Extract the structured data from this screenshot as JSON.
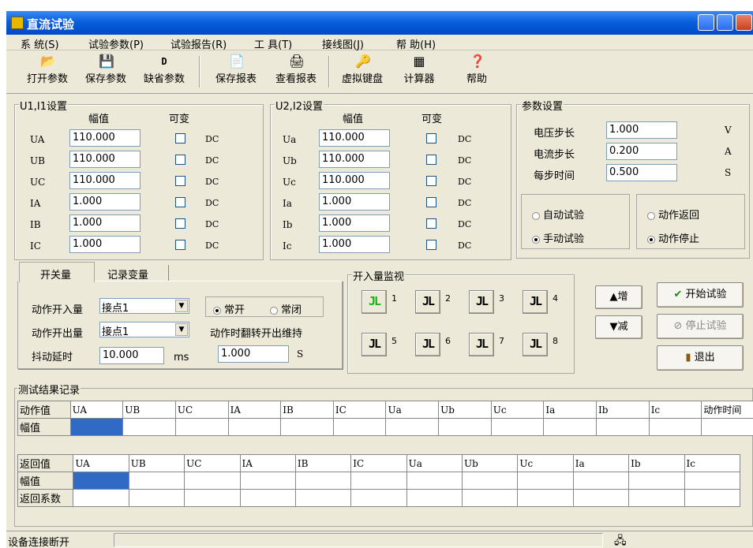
{
  "window": {
    "title": "直流试验"
  },
  "menu": [
    "系 统(S)",
    "试验参数(P)",
    "试验报告(R)",
    "工 具(T)",
    "接线图(J)",
    "帮 助(H)"
  ],
  "toolbar": [
    "打开参数",
    "保存参数",
    "缺省参数",
    "保存报表",
    "查看报表",
    "虚拟键盘",
    "计算器",
    "帮助"
  ],
  "g1": {
    "title": "U1,I1设置",
    "amp_header": "幅值",
    "var_header": "可变",
    "rows": [
      {
        "label": "UA",
        "value": "110.000",
        "unit": "DC"
      },
      {
        "label": "UB",
        "value": "110.000",
        "unit": "DC"
      },
      {
        "label": "UC",
        "value": "110.000",
        "unit": "DC"
      },
      {
        "label": "IA",
        "value": "1.000",
        "unit": "DC"
      },
      {
        "label": "IB",
        "value": "1.000",
        "unit": "DC"
      },
      {
        "label": "IC",
        "value": "1.000",
        "unit": "DC"
      }
    ]
  },
  "g2": {
    "title": "U2,I2设置",
    "amp_header": "幅值",
    "var_header": "可变",
    "rows": [
      {
        "label": "Ua",
        "value": "110.000",
        "unit": "DC"
      },
      {
        "label": "Ub",
        "value": "110.000",
        "unit": "DC"
      },
      {
        "label": "Uc",
        "value": "110.000",
        "unit": "DC"
      },
      {
        "label": "Ia",
        "value": "1.000",
        "unit": "DC"
      },
      {
        "label": "Ib",
        "value": "1.000",
        "unit": "DC"
      },
      {
        "label": "Ic",
        "value": "1.000",
        "unit": "DC"
      }
    ]
  },
  "params": {
    "title": "参数设置",
    "rows": [
      {
        "label": "电压步长",
        "value": "1.000",
        "unit": "V"
      },
      {
        "label": "电流步长",
        "value": "0.200",
        "unit": "A"
      },
      {
        "label": "每步时间",
        "value": "0.500",
        "unit": "S"
      }
    ],
    "mode_auto": "自动试验",
    "mode_manual": "手动试验",
    "act_return": "动作返回",
    "act_stop": "动作停止"
  },
  "tabs": {
    "t1": "开关量",
    "t2": "记录变量",
    "in_label": "动作开入量",
    "in_value": "接点1",
    "out_label": "动作开出量",
    "out_value": "接点1",
    "delay_label": "抖动延时",
    "delay_value": "10.000",
    "delay_unit": "ms",
    "no": "常开",
    "nc": "常闭",
    "hold_label": "动作时翻转开出维持",
    "hold_value": "1.000",
    "hold_unit": "S"
  },
  "monitor": {
    "title": "开入量监视",
    "glyph": "JL",
    "nums": [
      "1",
      "2",
      "3",
      "4",
      "5",
      "6",
      "7",
      "8"
    ],
    "lit_state": "input 1 active (green)"
  },
  "buttons": {
    "inc": "增",
    "dec": "减",
    "start": "开始试验",
    "stop": "停止试验",
    "exit": "退出"
  },
  "results": {
    "title": "测试结果记录",
    "t1_header": [
      "动作值",
      "UA",
      "UB",
      "UC",
      "IA",
      "IB",
      "IC",
      "Ua",
      "Ub",
      "Uc",
      "Ia",
      "Ib",
      "Ic",
      "动作时间"
    ],
    "t1_row": "幅值",
    "t2_header": [
      "返回值",
      "UA",
      "UB",
      "UC",
      "IA",
      "IB",
      "IC",
      "Ua",
      "Ub",
      "Uc",
      "Ia",
      "Ib",
      "Ic"
    ],
    "t2_rows": [
      "幅值",
      "返回系数"
    ]
  },
  "status": {
    "text": "设备连接断开"
  },
  "colors": {
    "title_bar": "#0a5fdc",
    "window_bg": "#ece9d8",
    "selection": "#316ac5",
    "active_input": "#18b018"
  }
}
